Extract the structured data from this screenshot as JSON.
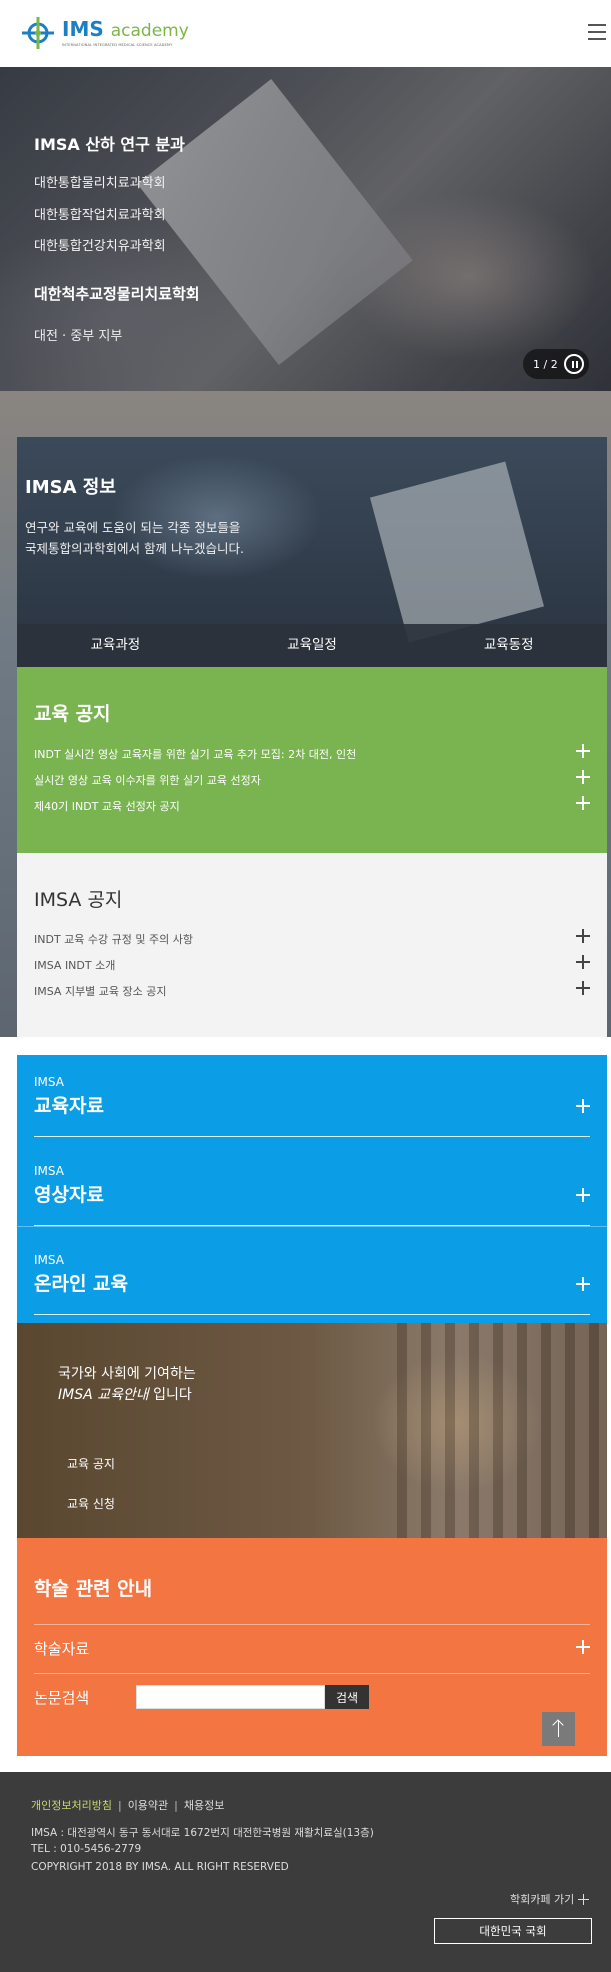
{
  "header": {
    "logo_name": "IMS",
    "logo_academy": "academy",
    "logo_sub": "INTERNATIONAL INTEGRATED MEDICAL SCIENCE ACADEMY"
  },
  "hero": {
    "title": "IMSA 산하 연구 분과",
    "items": [
      "대한통합물리치료과학회",
      "대한통합작업치료과학회",
      "대한통합건강치유과학회"
    ],
    "subtitle": "대한척추교정물리치료학회",
    "branch": "대전 · 중부 지부",
    "pager": "1 / 2"
  },
  "info": {
    "title": "IMSA 정보",
    "desc": [
      "연구와 교육에 도움이 되는 각종 정보들을",
      "국제통합의과학회에서 함께 나누겠습니다."
    ],
    "tabs": [
      "교육과정",
      "교육일정",
      "교육동정"
    ]
  },
  "edu_notice": {
    "title": "교육 공지",
    "items": [
      "INDT 실시간 영상 교육자를 위한 실기 교육 추가 모집: 2차 대전, 인천",
      "실시간 영상 교육 이수자를 위한 실기 교육 선정자",
      "제40기 INDT 교육 선정자 공지"
    ]
  },
  "imsa_notice": {
    "title": "IMSA 공지",
    "items": [
      "INDT 교육 수강 규정 및 주의 사항",
      "IMSA INDT 소개",
      "IMSA 지부별 교육 장소 공지"
    ]
  },
  "resources": [
    {
      "small": "IMSA",
      "big": "교육자료"
    },
    {
      "small": "IMSA",
      "big": "영상자료"
    },
    {
      "small": "IMSA",
      "big": "온라인 교육"
    }
  ],
  "promo": {
    "line1": "국가와 사회에 기여하는",
    "line2_a": "IMSA 교육안내",
    "line2_b": "입니다",
    "links": [
      "교육 공지",
      "교육 신청"
    ]
  },
  "academic": {
    "title": "학술 관련 안내",
    "row": "학술자료",
    "search_label": "논문검색",
    "search_value": "",
    "search_button": "검색"
  },
  "footer": {
    "links": [
      "개인정보처리방침",
      "이용약관",
      "채용정보"
    ],
    "address": "IMSA : 대전광역시 동구 동서대로 1672번지 대전한국병원 재활치료실(13층)",
    "tel": "TEL : 010-5456-2779",
    "copyright": "COPYRIGHT 2018 BY IMSA. ALL RIGHT RESERVED",
    "cafe": "학회카페 가기",
    "assembly": "대한민국 국회"
  },
  "colors": {
    "green": "#7ab450",
    "blue": "#0b9ee6",
    "orange": "#f27542",
    "footer": "#3c3c3c"
  }
}
